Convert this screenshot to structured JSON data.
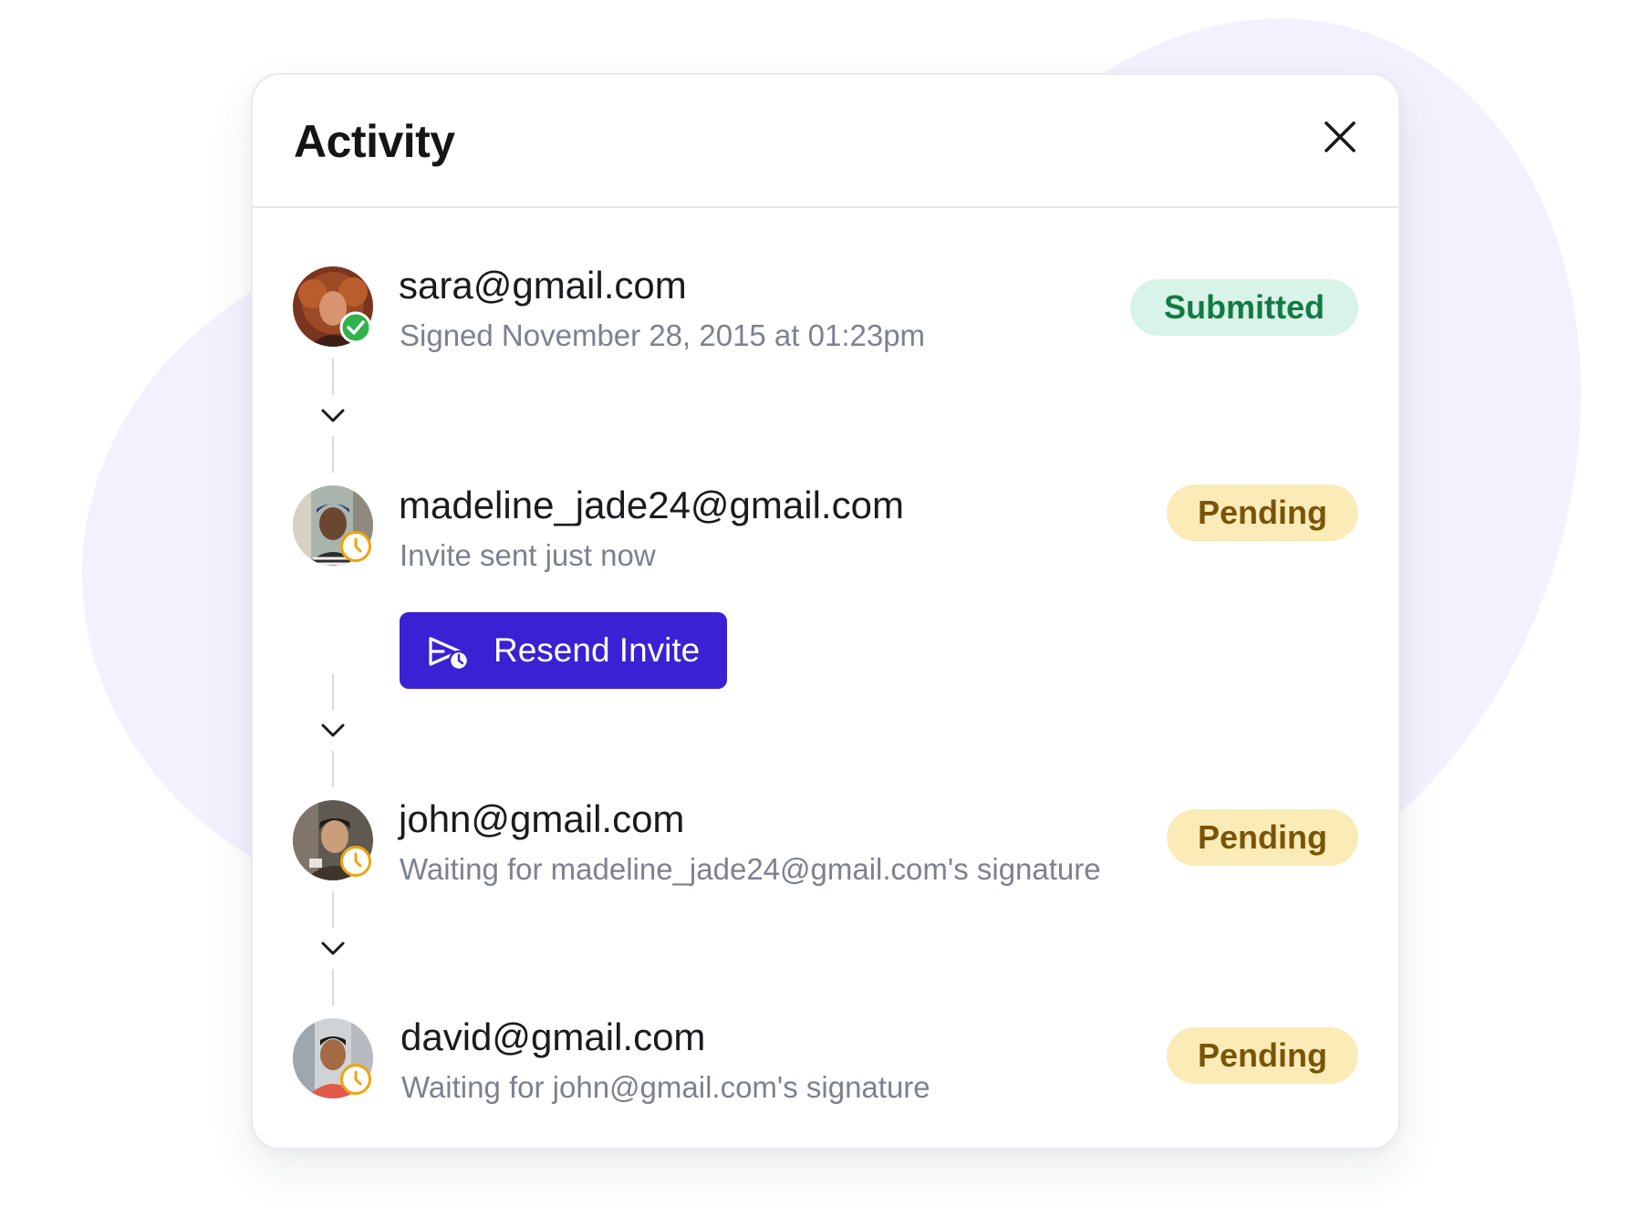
{
  "panel": {
    "title": "Activity",
    "close_icon": "close-icon"
  },
  "colors": {
    "accent": "#3a21d4",
    "submitted_bg": "#d8f3e8",
    "submitted_text": "#127a42",
    "pending_bg": "#fbecb7",
    "pending_text": "#7a5408",
    "background_blob": "#f2f1fd"
  },
  "activities": [
    {
      "email": "sara@gmail.com",
      "description": "Signed November 28, 2015 at 01:23pm",
      "status": "Submitted",
      "status_icon": "check-circle-icon"
    },
    {
      "email": "madeline_jade24@gmail.com",
      "description": "Invite sent just now",
      "status": "Pending",
      "status_icon": "clock-icon",
      "action": {
        "label": "Resend Invite",
        "icon": "send-later-icon"
      }
    },
    {
      "email": "john@gmail.com",
      "description": "Waiting for madeline_jade24@gmail.com's signature",
      "status": "Pending",
      "status_icon": "clock-icon"
    },
    {
      "email": "david@gmail.com",
      "description": "Waiting for john@gmail.com's signature",
      "status": "Pending",
      "status_icon": "clock-icon"
    }
  ]
}
